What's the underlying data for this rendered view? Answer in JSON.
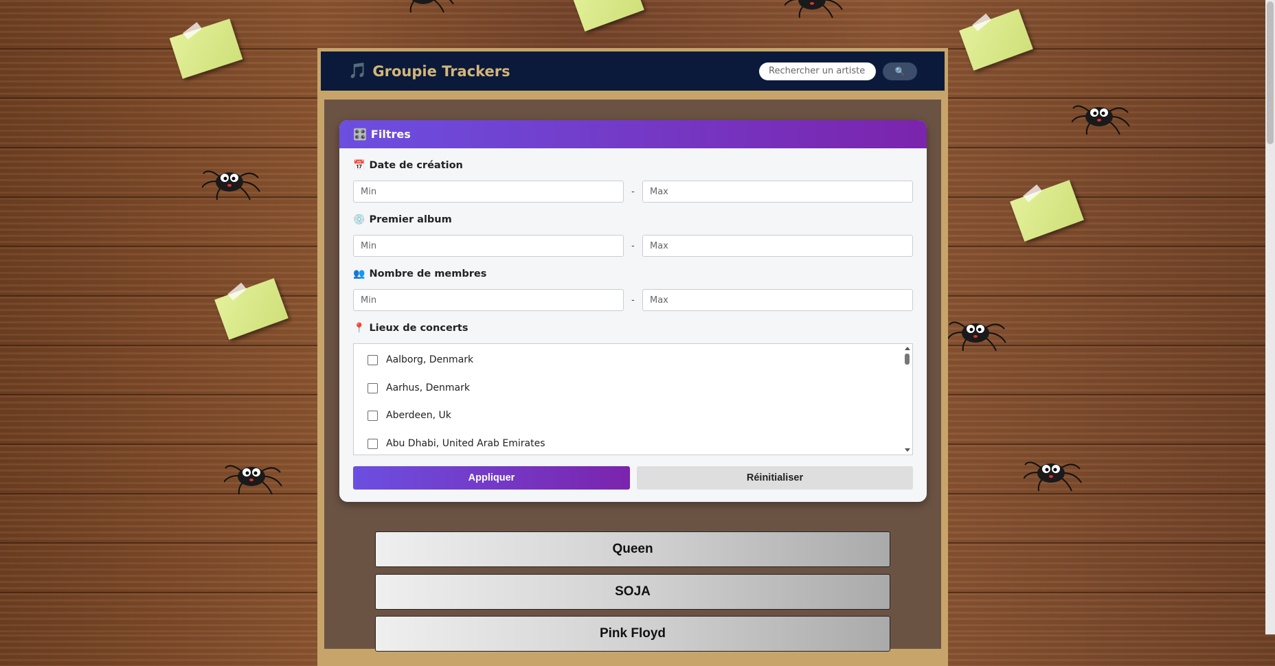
{
  "header": {
    "brand_icon": "music-note-icon",
    "title": "Groupie Trackers",
    "search_placeholder": "Rechercher un artiste",
    "search_button_icon": "🔍"
  },
  "filters": {
    "title": "Filtres",
    "title_icon": "🎛️",
    "creation_date": {
      "icon": "📅",
      "label": "Date de création",
      "min_placeholder": "Min",
      "max_placeholder": "Max",
      "separator": "-"
    },
    "first_album": {
      "icon": "💿",
      "label": "Premier album",
      "min_placeholder": "Min",
      "max_placeholder": "Max",
      "separator": "-"
    },
    "members": {
      "icon": "👥",
      "label": "Nombre de membres",
      "min_placeholder": "Min",
      "max_placeholder": "Max",
      "separator": "-"
    },
    "locations": {
      "icon": "📍",
      "label": "Lieux de concerts",
      "items": [
        "Aalborg, Denmark",
        "Aarhus, Denmark",
        "Aberdeen, Uk",
        "Abu Dhabi, United Arab Emirates"
      ]
    },
    "apply_label": "Appliquer",
    "reset_label": "Réinitialiser"
  },
  "artists": [
    "Queen",
    "SOJA",
    "Pink Floyd"
  ],
  "colors": {
    "header_bg": "#0b1a3a",
    "brand": "#d4b67a",
    "accent_start": "#6c4fe0",
    "accent_end": "#7b24ad"
  }
}
